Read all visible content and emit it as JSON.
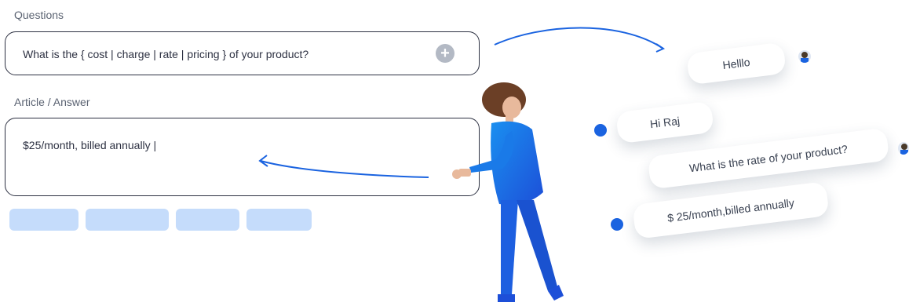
{
  "questions": {
    "label": "Questions",
    "value": "What is the { cost | charge | rate | pricing } of your product?"
  },
  "answer": {
    "label": "Article / Answer",
    "value": "$25/month, billed annually |"
  },
  "chips": [
    "",
    "",
    "",
    ""
  ],
  "chat": {
    "messages": [
      {
        "text": "Helllo",
        "sender": "user"
      },
      {
        "text": "Hi Raj",
        "sender": "bot"
      },
      {
        "text": "What is the rate of your product?",
        "sender": "user"
      },
      {
        "text": "$ 25/month,billed annually",
        "sender": "bot"
      }
    ]
  },
  "colors": {
    "accent": "#1a63e0",
    "chip": "#c5dcfb",
    "arrow": "#1a63e0"
  },
  "icons": {
    "add": "plus-circle-icon",
    "bot_avatar": "bot-icon",
    "user_avatar": "user-avatar-icon"
  }
}
